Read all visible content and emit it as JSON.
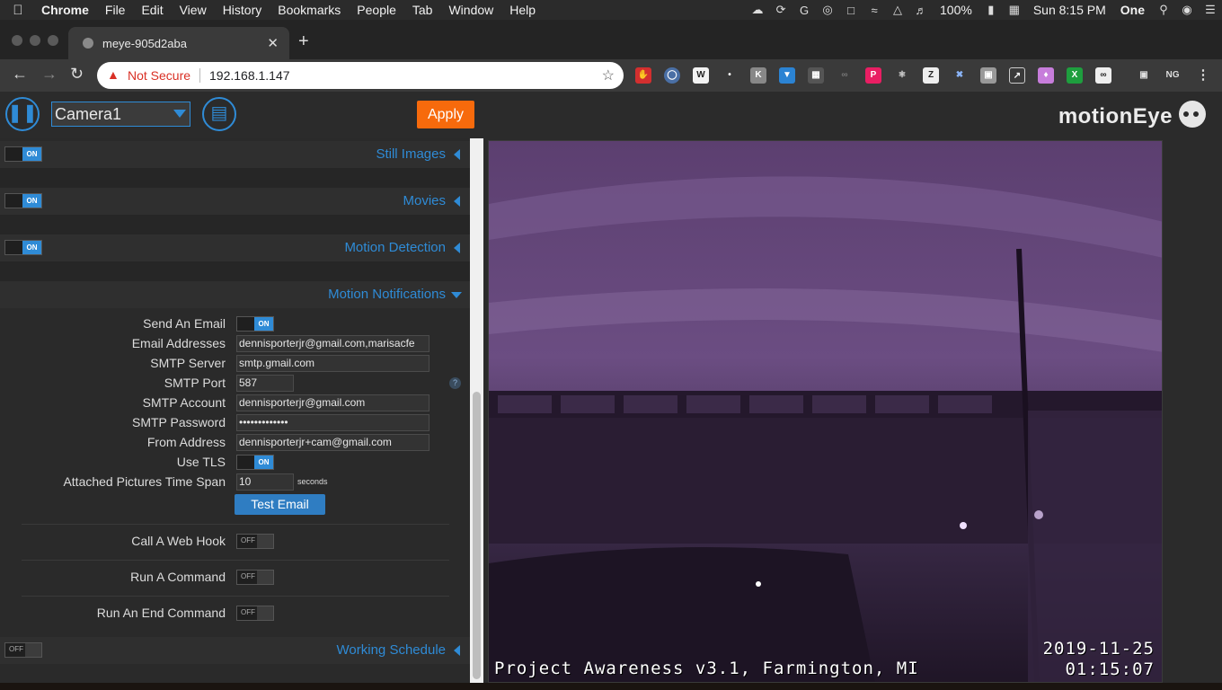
{
  "menubar": {
    "app": "Chrome",
    "items": [
      "File",
      "Edit",
      "View",
      "History",
      "Bookmarks",
      "People",
      "Tab",
      "Window",
      "Help"
    ],
    "battery": "100%",
    "clock": "Sun 8:15 PM",
    "user": "One"
  },
  "browser": {
    "tab_title": "meye-905d2aba",
    "security": "Not Secure",
    "url": "192.168.1.147"
  },
  "header": {
    "camera": "Camera1",
    "apply": "Apply"
  },
  "sections": {
    "still_images": "Still Images",
    "movies": "Movies",
    "motion_detection": "Motion Detection",
    "motion_notifications": "Motion Notifications",
    "working_schedule": "Working Schedule"
  },
  "toggles": {
    "on": "ON",
    "off": "OFF"
  },
  "notifications": {
    "send_email_label": "Send An Email",
    "email_addresses_label": "Email Addresses",
    "email_addresses_value": "dennisporterjr@gmail.com,marisacfe",
    "smtp_server_label": "SMTP Server",
    "smtp_server_value": "smtp.gmail.com",
    "smtp_port_label": "SMTP Port",
    "smtp_port_value": "587",
    "smtp_account_label": "SMTP Account",
    "smtp_account_value": "dennisporterjr@gmail.com",
    "smtp_password_label": "SMTP Password",
    "smtp_password_value": "•••••••••••••",
    "from_address_label": "From Address",
    "from_address_value": "dennisporterjr+cam@gmail.com",
    "use_tls_label": "Use TLS",
    "time_span_label": "Attached Pictures Time Span",
    "time_span_value": "10",
    "time_span_unit": "seconds",
    "test_email": "Test Email",
    "help": "?",
    "web_hook_label": "Call A Web Hook",
    "run_command_label": "Run A Command",
    "end_command_label": "Run An End Command"
  },
  "camera_view": {
    "brand": "motionEye",
    "overlay_left": "Project Awareness v3.1, Farmington, MI",
    "overlay_date": "2019-11-25",
    "overlay_time": "01:15:07"
  },
  "colors": {
    "accent": "#2f8bd6",
    "apply": "#f76a0c"
  }
}
